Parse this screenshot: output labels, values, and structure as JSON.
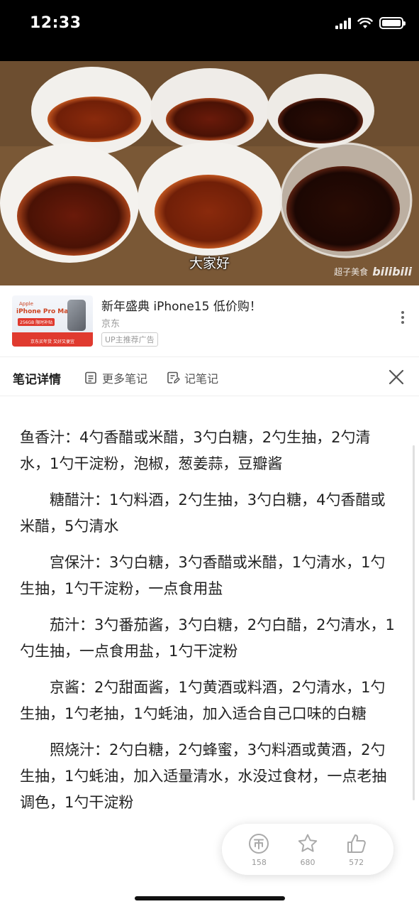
{
  "status_bar": {
    "time": "12:33"
  },
  "video": {
    "subtitle": "大家好",
    "watermark_author": "超子美食",
    "watermark_brand": "bilibili"
  },
  "ad": {
    "title": "新年盛典 iPhone15 低价购！",
    "brand": "京东",
    "tag": "UP主推荐广告",
    "thumb_line1": "Apple",
    "thumb_line2": "iPhone Pro Max",
    "thumb_line3": "256GB 限时补贴",
    "thumb_line4": "京东买年货 又好又便宜"
  },
  "note_header": {
    "title": "笔记详情",
    "more_notes": "更多笔记",
    "write_note": "记笔记"
  },
  "note": {
    "paragraphs": [
      "鱼香汁：4勺香醋或米醋，3勺白糖，2勺生抽，2勺清水，1勺干淀粉，泡椒，葱姜蒜，豆瓣酱",
      "　　糖醋汁：1勺料酒，2勺生抽，3勺白糖，4勺香醋或米醋，5勺清水",
      "　　宫保汁：3勺白糖，3勺香醋或米醋，1勺清水，1勺生抽，1勺干淀粉，一点食用盐",
      "　　茄汁：3勺番茄酱，3勺白糖，2勺白醋，2勺清水，1勺生抽，一点食用盐，1勺干淀粉",
      "　　京酱：2勺甜面酱，1勺黄酒或料酒，2勺清水，1勺生抽，1勺老抽，1勺蚝油，加入适合自己口味的白糖",
      "　　照烧汁：2勺白糖，2勺蜂蜜，3勺料酒或黄酒，2勺生抽，1勺蚝油，加入适量清水，水没过食材，一点老抽调色，1勺干淀粉"
    ]
  },
  "actions": {
    "coin_count": "158",
    "favorite_count": "680",
    "like_count": "572"
  }
}
